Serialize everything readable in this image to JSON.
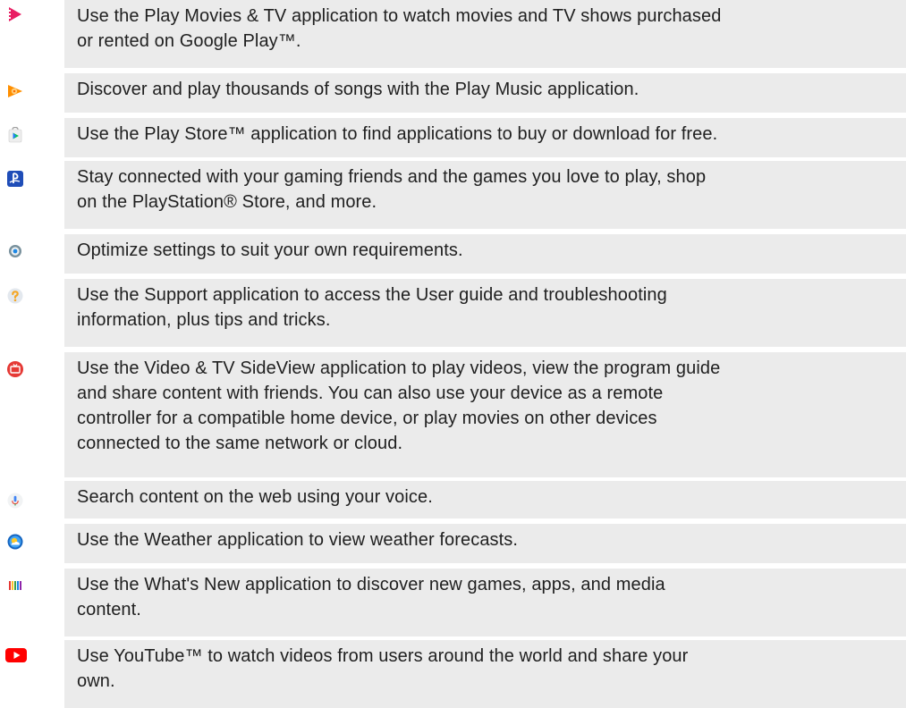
{
  "apps": [
    {
      "icon": "play-movies-icon",
      "text": "Use the Play Movies & TV application to watch movies and TV shows purchased\nor rented on Google Play™."
    },
    {
      "icon": "play-music-icon",
      "text": "Discover and play thousands of songs with the Play Music application."
    },
    {
      "icon": "play-store-icon",
      "text": "Use the Play Store™ application to find applications to buy or download for free."
    },
    {
      "icon": "playstation-icon",
      "text": "Stay connected with your gaming friends and the games you love to play, shop\non the PlayStation® Store, and more."
    },
    {
      "icon": "settings-gear-icon",
      "text": "Optimize settings to suit your own requirements."
    },
    {
      "icon": "support-question-icon",
      "text": "Use the Support application to access the User guide and troubleshooting\ninformation, plus tips and tricks."
    },
    {
      "icon": "video-tv-sideview-icon",
      "text": "Use the Video & TV SideView application to play videos, view the program guide\nand share content with friends. You can also use your device as a remote\ncontroller for a compatible home device, or play movies on other devices\nconnected to the same network or cloud."
    },
    {
      "icon": "voice-search-microphone-icon",
      "text": "Search content on the web using your voice."
    },
    {
      "icon": "weather-icon",
      "text": "Use the Weather application to view weather forecasts."
    },
    {
      "icon": "whats-new-icon",
      "text": "Use the What's New application to discover new games, apps, and media\ncontent."
    },
    {
      "icon": "youtube-icon",
      "text": "Use YouTube™ to watch videos from users around the world and share your\nown."
    }
  ],
  "colors": {
    "row_background": "#ebebeb",
    "text": "#1f1f1f",
    "play_movies": "#e91e63",
    "play_music": "#ff6f00",
    "playstation": "#1f4db8",
    "youtube": "#ff0000",
    "sideview": "#e53935"
  }
}
